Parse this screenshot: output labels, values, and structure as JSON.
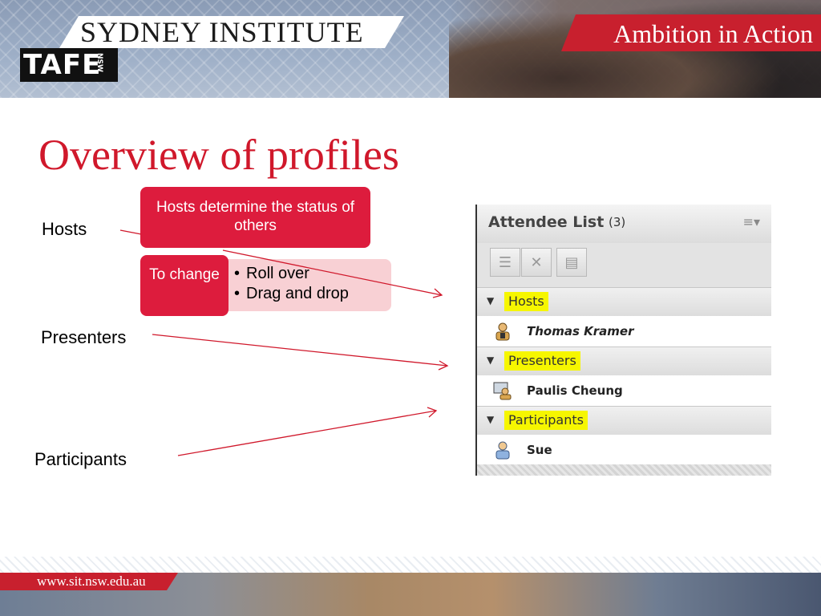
{
  "header": {
    "institute_name": "SYDNEY INSTITUTE",
    "logo_text": "TAFE",
    "logo_sub": "NSW",
    "tagline": "Ambition in Action"
  },
  "slide": {
    "title": "Overview of profiles",
    "labels": {
      "hosts": "Hosts",
      "presenters": "Presenters",
      "participants": "Participants"
    },
    "diagram": {
      "hosts_box": "Hosts determine the status of others",
      "change_box": "To change",
      "bullets": [
        "Roll over",
        "Drag and drop"
      ]
    }
  },
  "attendee_panel": {
    "title": "Attendee List",
    "count": "(3)",
    "menu_icon": "menu-icon",
    "sections": [
      {
        "name": "Hosts",
        "person": "Thomas Kramer",
        "icon": "host-user-icon"
      },
      {
        "name": "Presenters",
        "person": "Paulis Cheung",
        "icon": "presenter-user-icon"
      },
      {
        "name": "Participants",
        "person": "Sue",
        "icon": "participant-user-icon"
      }
    ],
    "highlight_color": "#f6f600"
  },
  "footer": {
    "url": "www.sit.nsw.edu.au"
  },
  "colors": {
    "accent_red": "#d0182b",
    "box_red": "#dd1c3d",
    "box_pink": "#f8d0d4"
  }
}
